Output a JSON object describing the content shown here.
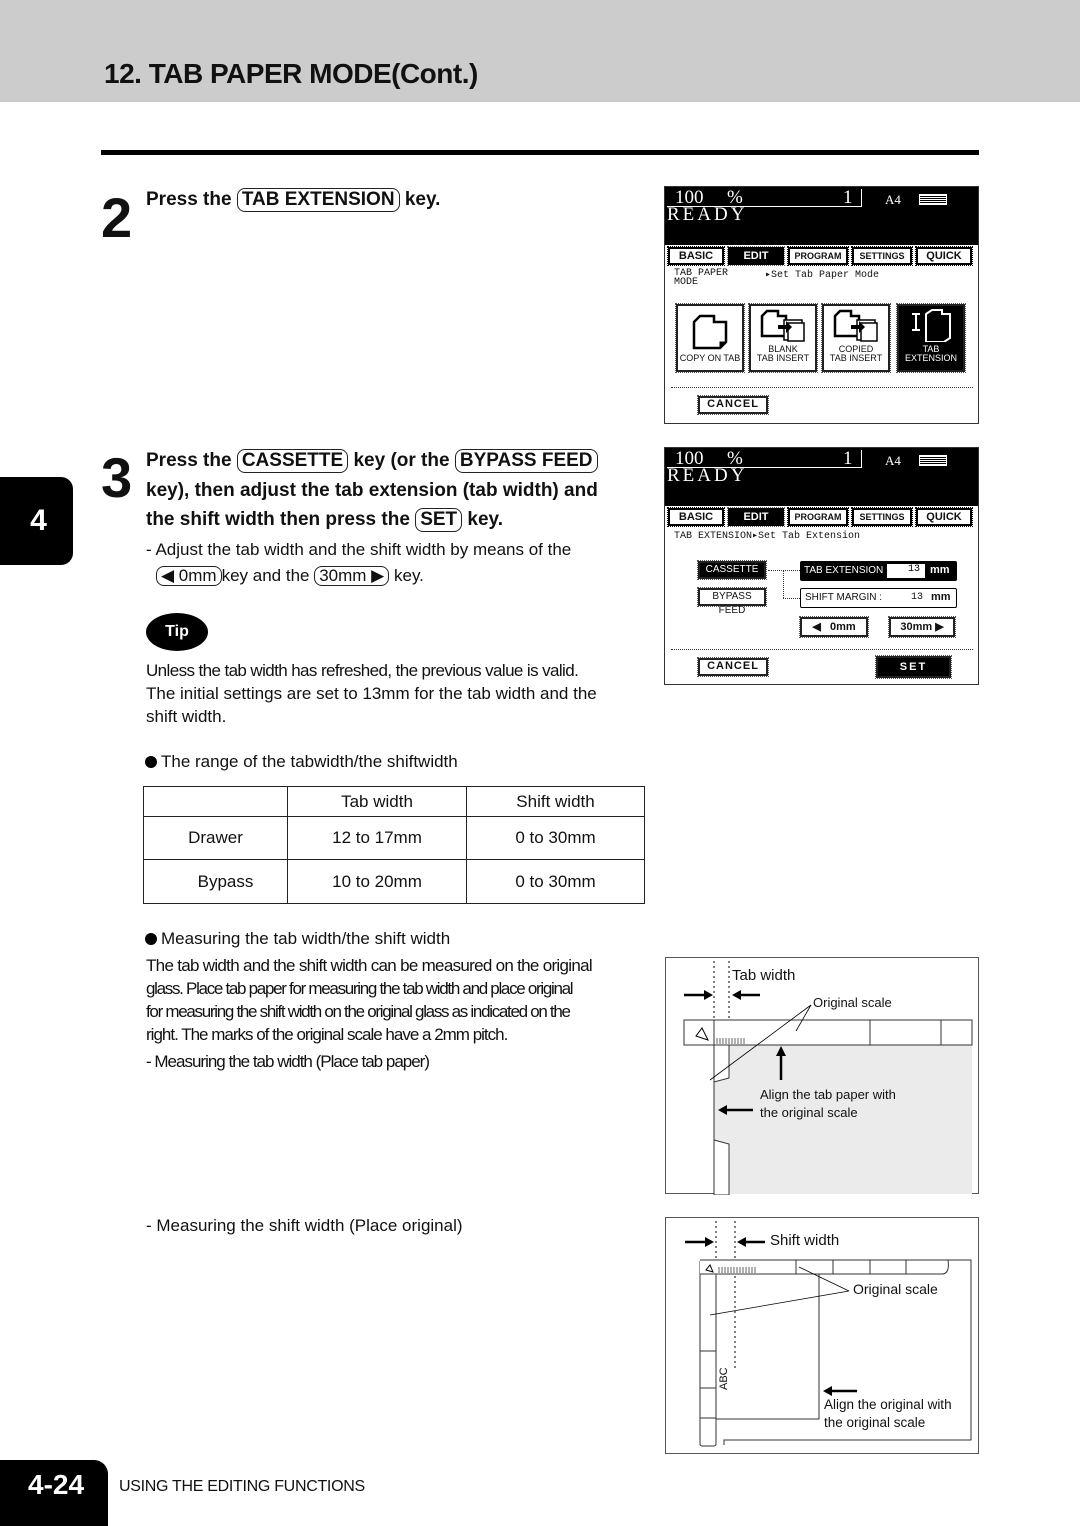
{
  "header": {
    "title": "12. TAB PAPER MODE(Cont.)"
  },
  "chapter_tab": "4",
  "step2": {
    "number": "2",
    "prefix": "Press the",
    "key": "TAB EXTENSION",
    "suffix": "key."
  },
  "panel1": {
    "zoom": "100",
    "percent": "%",
    "copies": "1",
    "paper_size": "A4",
    "status": "READY",
    "tabs": [
      "BASIC",
      "EDIT",
      "PROGRAM",
      "SETTINGS",
      "QUICK"
    ],
    "active_tab": "EDIT",
    "crumb_left_1": "TAB PAPER",
    "crumb_left_2": "MODE",
    "crumb_right": "▸Set Tab Paper Mode",
    "options": [
      {
        "line1": "",
        "line2": "COPY ON TAB",
        "icon": "folder-tab-icon"
      },
      {
        "line1": "BLANK",
        "line2": "TAB INSERT",
        "icon": "blank-tab-insert-icon"
      },
      {
        "line1": "COPIED",
        "line2": "TAB INSERT",
        "icon": "copied-tab-insert-icon"
      },
      {
        "line1": "TAB",
        "line2": "EXTENSION",
        "icon": "tab-extension-icon"
      }
    ],
    "cancel": "CANCEL"
  },
  "step3": {
    "number": "3",
    "line1_prefix": "Press the",
    "key_cassette": "CASSETTE",
    "line1_mid": "key (or the",
    "key_bypass": "BYPASS FEED",
    "line2": "key), then adjust the tab extension (tab width) and",
    "line3_prefix": "the shift width then press the",
    "key_set": "SET",
    "line3_suffix": "key.",
    "sub1": "-  Adjust the tab width and the shift width by means of the",
    "key_0mm": "◀ 0mm",
    "sub2_mid": "key and the",
    "key_30mm": "30mm ▶",
    "sub2_suffix": "key."
  },
  "panel2": {
    "zoom": "100",
    "percent": "%",
    "copies": "1",
    "paper_size": "A4",
    "status": "READY",
    "tabs": [
      "BASIC",
      "EDIT",
      "PROGRAM",
      "SETTINGS",
      "QUICK"
    ],
    "crumb": "TAB EXTENSION▸Set Tab Extension",
    "cassette": "CASSETTE",
    "bypass": "BYPASS FEED",
    "tab_ext_label": "TAB EXTENSION :",
    "tab_ext_value": "13",
    "shift_label": "SHIFT MARGIN :",
    "shift_value": "13",
    "unit": "mm",
    "btn_0mm": "◀   0mm",
    "btn_30mm": "30mm ▶",
    "cancel": "CANCEL",
    "set": "SET"
  },
  "tip": {
    "badge": "Tip",
    "line1": "Unless the tab width has refreshed, the previous value is valid.",
    "line2": "The initial settings are set to 13mm for the tab width and the",
    "line3": "shift width."
  },
  "range_section": {
    "heading": "The range of the tabwidth/the shiftwidth",
    "columns": [
      "",
      "Tab width",
      "Shift width"
    ],
    "rows": [
      [
        "Drawer",
        "12 to 17mm",
        "0 to 30mm"
      ],
      [
        "Bypass",
        "10 to 20mm",
        "0 to 30mm"
      ]
    ]
  },
  "measure_section": {
    "heading": "Measuring the tab width/the shift width",
    "para": [
      "The tab width and the shift width can be measured on the original",
      "glass.  Place tab paper for measuring the tab width and place original",
      "for measuring the shift width on the original glass as indicated on the",
      "right. The marks of the original scale have a 2mm pitch."
    ],
    "sub_tab": "- Measuring the tab width (Place tab paper)",
    "sub_shift": "- Measuring the shift width (Place original)"
  },
  "figure1": {
    "label_tab_width": "Tab width",
    "label_scale": "Original scale",
    "align_1": "Align the tab paper with",
    "align_2": "the original scale"
  },
  "figure2": {
    "label_shift_width": "Shift width",
    "label_scale": "Original scale",
    "abc": "ABC",
    "align_1": "Align the original with",
    "align_2": "the original scale"
  },
  "footer": {
    "page_number": "4-24",
    "section": "USING THE EDITING FUNCTIONS"
  }
}
